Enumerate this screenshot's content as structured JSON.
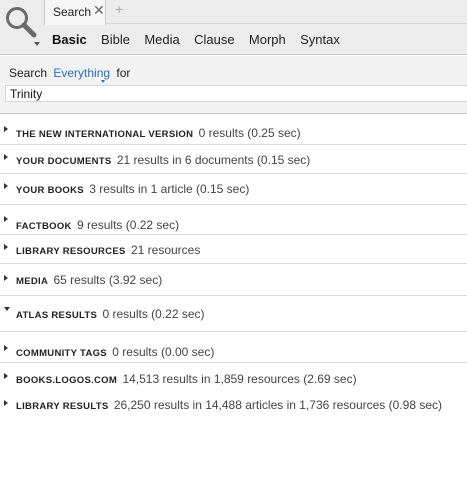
{
  "tab": {
    "label": "Search",
    "close": "✕",
    "add": "+"
  },
  "modes": [
    "Basic",
    "Bible",
    "Media",
    "Clause",
    "Morph",
    "Syntax"
  ],
  "search": {
    "prefix": "Search",
    "scope": "Everything",
    "suffix": "for",
    "query": "Trinity"
  },
  "results": [
    {
      "title": "THE NEW INTERNATIONAL VERSION",
      "detail": "0 results (0.25 sec)",
      "expanded": false
    },
    {
      "title": "YOUR DOCUMENTS",
      "detail": "21 results in 6 documents (0.15 sec)",
      "expanded": false
    },
    {
      "title": "YOUR BOOKS",
      "detail": "3 results in 1 article (0.15 sec)",
      "expanded": false
    },
    {
      "title": "FACTBOOK",
      "detail": "9 results (0.22 sec)",
      "expanded": false
    },
    {
      "title": "LIBRARY RESOURCES",
      "detail": "21 resources",
      "expanded": false
    },
    {
      "title": "MEDIA",
      "detail": "65 results (3.92 sec)",
      "expanded": false
    },
    {
      "title": "ATLAS RESULTS",
      "detail": "0 results (0.22 sec)",
      "expanded": true
    },
    {
      "title": "COMMUNITY TAGS",
      "detail": "0 results (0.00 sec)",
      "expanded": false
    },
    {
      "title": "BOOKS.LOGOS.COM",
      "detail": "14,513 results in 1,859 resources (2.69 sec)",
      "expanded": false
    },
    {
      "title": "LIBRARY RESULTS",
      "detail": "26,250 results in 14,488 articles in 1,736 resources (0.98 sec)",
      "expanded": false
    }
  ]
}
